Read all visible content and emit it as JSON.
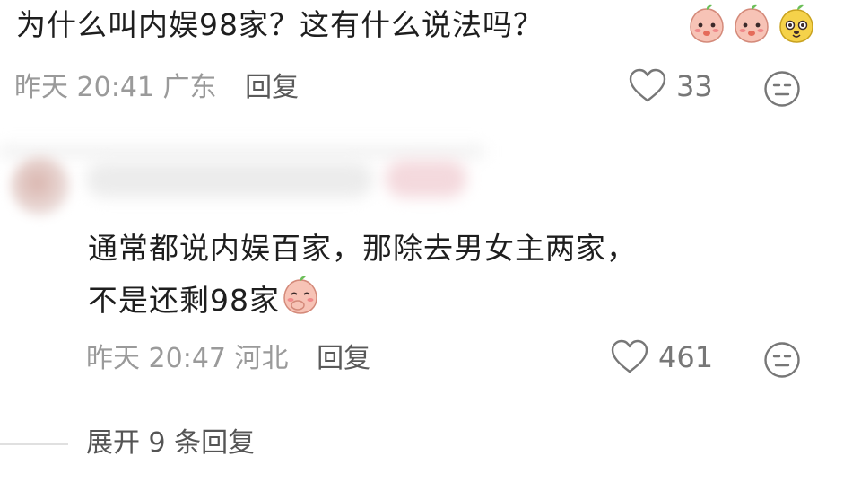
{
  "comment": {
    "text": "为什么叫内娱98家？这有什么说法吗？",
    "emojis": [
      "peach-face-emoji",
      "peach-face-emoji",
      "yellow-dog-face-emoji"
    ],
    "time": "昨天 20:41",
    "location": "广东",
    "reply_label": "回复",
    "likes": "33"
  },
  "reply": {
    "author_blurred": true,
    "line1": "通常都说内娱百家，那除去男女主两家，",
    "line2": "不是还剩98家",
    "emoji": "peach-cover-mouth-emoji",
    "time": "昨天 20:47",
    "location": "河北",
    "reply_label": "回复",
    "likes": "461"
  },
  "expand": {
    "label": "展开 9 条回复"
  },
  "colors": {
    "text": "#1e1e1e",
    "meta": "#9a9a9a",
    "reply": "#5a5a5a",
    "background": "#ffffff"
  }
}
